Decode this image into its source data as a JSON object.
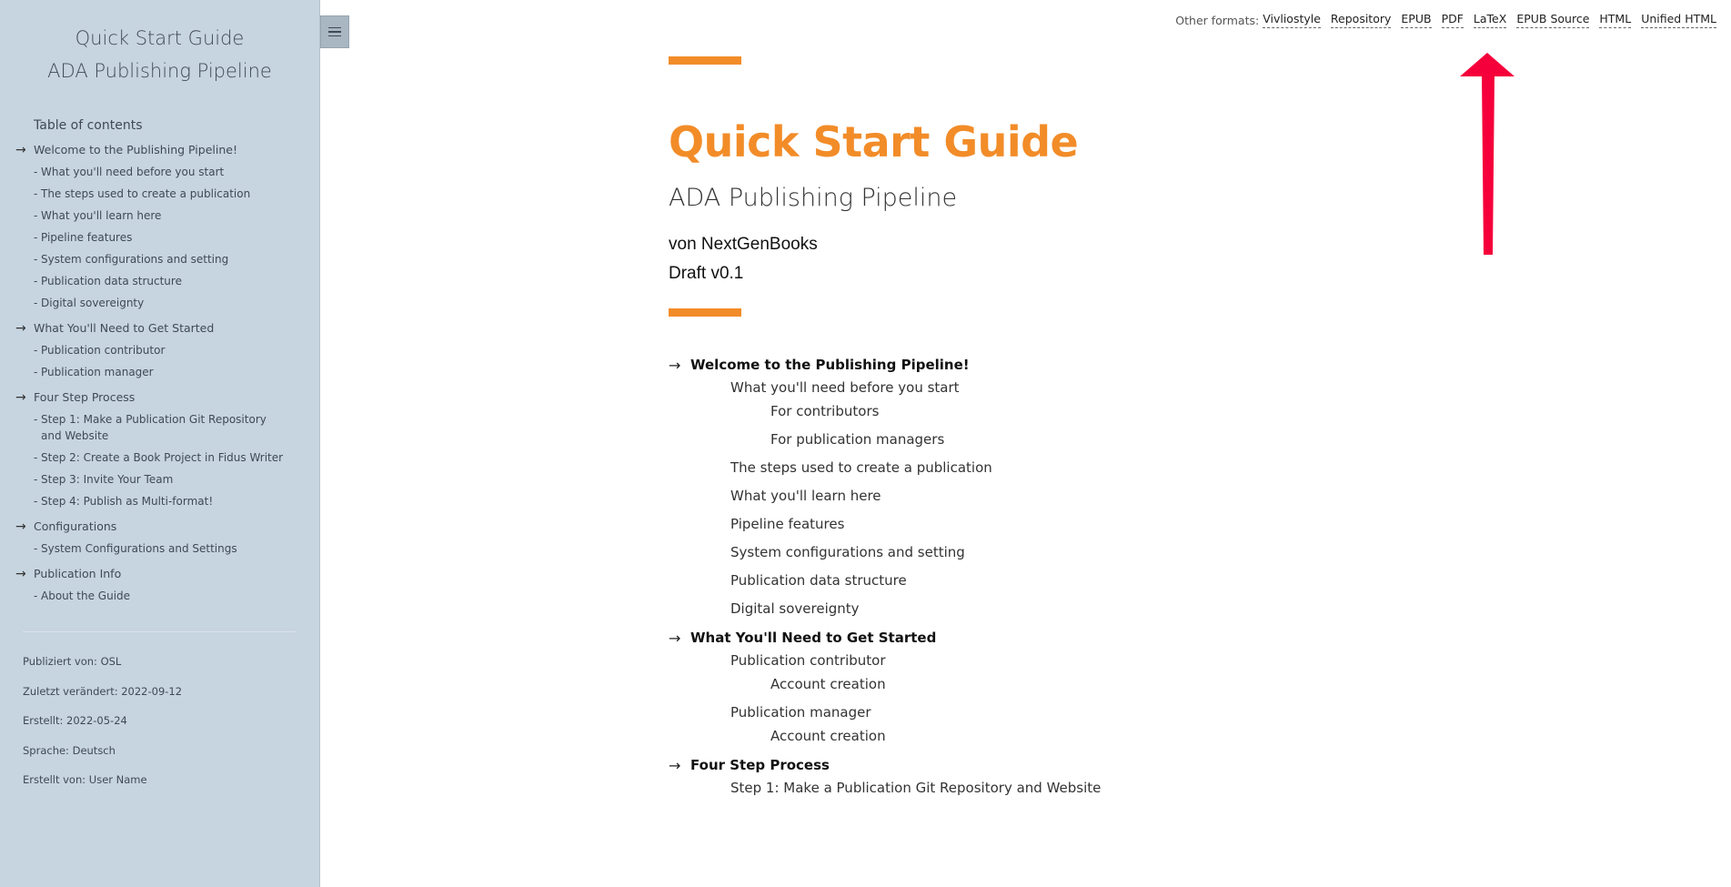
{
  "sidebar": {
    "title": "Quick Start Guide",
    "subtitle": "ADA Publishing Pipeline",
    "toc_heading": "Table of contents",
    "chapters": [
      {
        "label": "Welcome to the Publishing Pipeline!",
        "subs": [
          "What you'll need before you start",
          "The steps used to create a publication",
          "What you'll learn here",
          "Pipeline features",
          "System configurations and setting",
          "Publication data structure",
          "Digital sovereignty"
        ]
      },
      {
        "label": "What You'll Need to Get Started",
        "subs": [
          "Publication contributor",
          "Publication manager"
        ]
      },
      {
        "label": "Four Step Process",
        "subs": [
          "Step 1: Make a Publication Git Repository and Website",
          "Step 2: Create a Book Project in Fidus Writer",
          "Step 3: Invite Your Team",
          "Step 4: Publish as Multi-format!"
        ]
      },
      {
        "label": "Configurations",
        "subs": [
          "System Configurations and Settings"
        ]
      },
      {
        "label": "Publication Info",
        "subs": [
          "About the Guide"
        ]
      }
    ],
    "meta": {
      "published_by": "Publiziert von: OSL",
      "last_changed": "Zuletzt verändert: 2022-09-12",
      "created": "Erstellt: 2022-05-24",
      "language": "Sprache: Deutsch",
      "created_by": "Erstellt von: User Name"
    }
  },
  "formats": {
    "prefix": "Other formats:",
    "links": [
      "Vivliostyle",
      "Repository",
      "EPUB",
      "PDF",
      "LaTeX",
      "EPUB Source",
      "HTML",
      "Unified HTML"
    ]
  },
  "main": {
    "title": "Quick Start Guide",
    "subtitle": "ADA Publishing Pipeline",
    "author": "von NextGenBooks",
    "draft": "Draft v0.1",
    "toc": {
      "ch1": {
        "label": "Welcome to the Publishing Pipeline!",
        "s1": "What you'll need before you start",
        "s1a": "For contributors",
        "s1b": "For publication managers",
        "s2": "The steps used to create a publication",
        "s3": "What you'll learn here",
        "s4": "Pipeline features",
        "s5": "System configurations and setting",
        "s6": "Publication data structure",
        "s7": "Digital sovereignty"
      },
      "ch2": {
        "label": "What You'll Need to Get Started",
        "s1": "Publication contributor",
        "s1a": "Account creation",
        "s2": "Publication manager",
        "s2a": "Account creation"
      },
      "ch3": {
        "label": "Four Step Process",
        "s1": "Step 1: Make a Publication Git Repository and Website"
      }
    }
  },
  "colors": {
    "accent": "#f28c28",
    "sidebar_bg": "#c7d5e0",
    "annotation_arrow": "#f5003b"
  },
  "icons": {
    "menu": "hamburger-menu-icon",
    "chapter": "arrow-right-icon"
  }
}
